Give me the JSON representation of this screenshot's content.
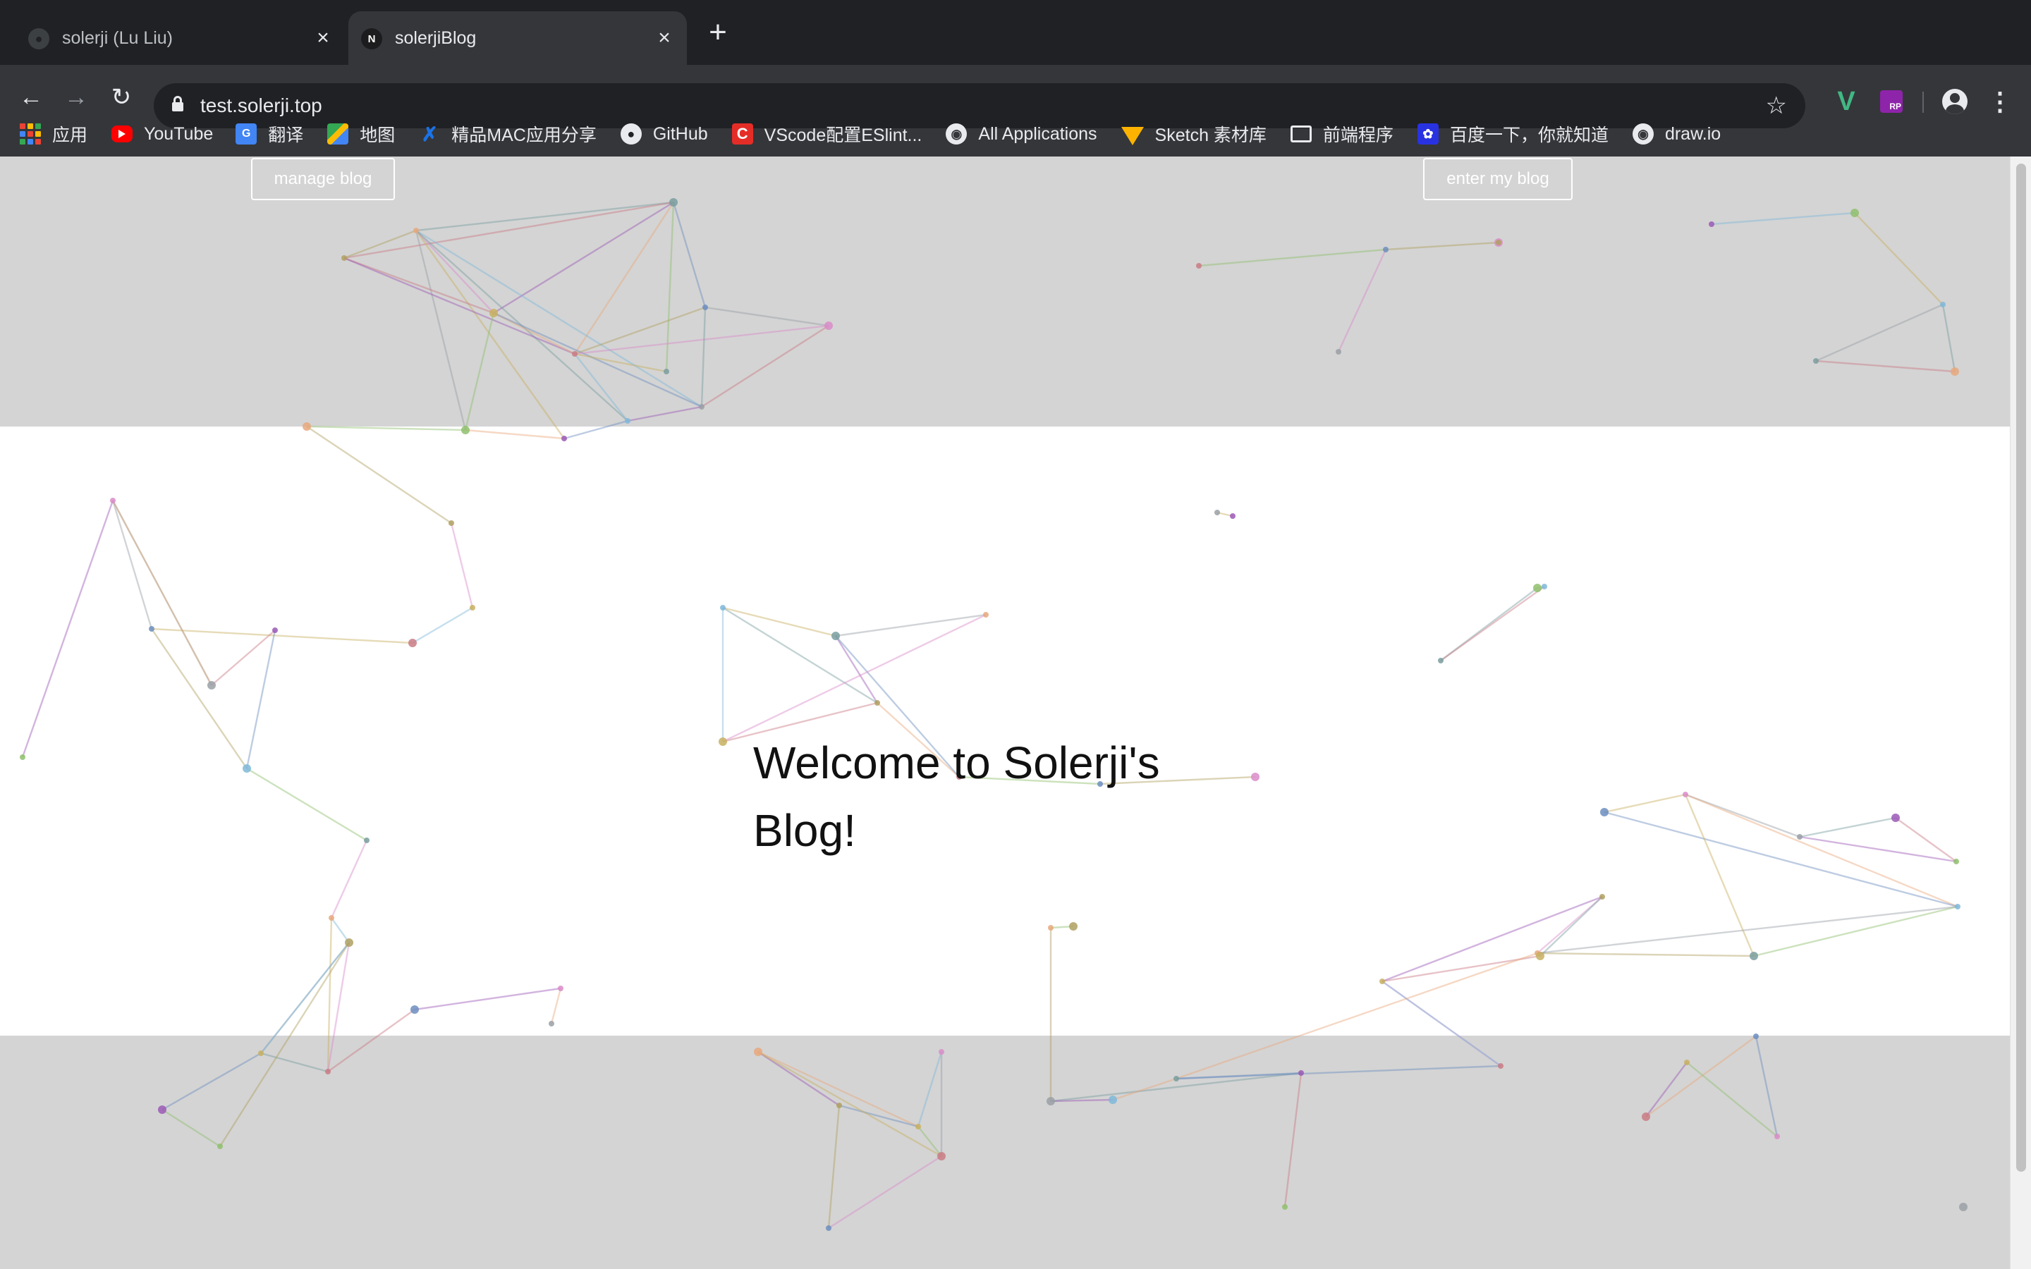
{
  "browser": {
    "tabs": [
      {
        "title": "solerji (Lu Liu)",
        "favicon": "github-icon",
        "active": false
      },
      {
        "title": "solerjiBlog",
        "favicon": "n-icon",
        "active": true
      }
    ],
    "url": "test.solerji.top",
    "bookmarks": [
      {
        "label": "应用",
        "icon": "apps-grid-icon"
      },
      {
        "label": "YouTube",
        "icon": "youtube-icon"
      },
      {
        "label": "翻译",
        "icon": "translate-icon"
      },
      {
        "label": "地图",
        "icon": "maps-icon"
      },
      {
        "label": "精品MAC应用分享",
        "icon": "x-icon"
      },
      {
        "label": "GitHub",
        "icon": "github-icon"
      },
      {
        "label": "VScode配置ESlint...",
        "icon": "codepen-icon"
      },
      {
        "label": "All Applications",
        "icon": "globe-icon"
      },
      {
        "label": "Sketch 素材库",
        "icon": "sketch-icon"
      },
      {
        "label": "前端程序",
        "icon": "folder-icon"
      },
      {
        "label": "百度一下，你就知道",
        "icon": "baidu-icon"
      },
      {
        "label": "draw.io",
        "icon": "globe-icon"
      }
    ]
  },
  "page": {
    "manage_button": "manage blog",
    "enter_button": "enter my blog",
    "welcome_text": "Welcome to Solerji's Blog!"
  },
  "colors": {
    "chrome_dark": "#202124",
    "chrome_toolbar": "#35363a",
    "band_gray": "#d4d4d4",
    "band_white": "#ffffff"
  }
}
